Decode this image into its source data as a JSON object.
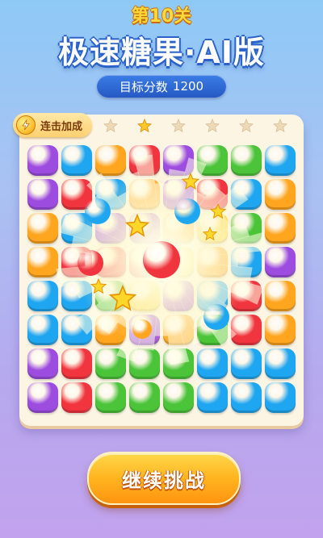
{
  "header": {
    "level_label": "第10关",
    "game_title": "极速糖果·AI版",
    "target_label": "目标分数",
    "target_score": "1200"
  },
  "combo_badge": {
    "label": "连击加成",
    "icon": "lightning-icon"
  },
  "progress_stars": {
    "total": 6,
    "active_index": 1
  },
  "board": {
    "columns": 8,
    "rows": 8,
    "cells": [
      [
        "purple",
        "blue",
        "orange",
        "red",
        "purple",
        "green",
        "green",
        "blue"
      ],
      [
        "purple",
        "red",
        "blue",
        "orange",
        "purple",
        "red",
        "blue",
        "orange"
      ],
      [
        "orange",
        "blue",
        "purple",
        "purple",
        "orange",
        "yellow",
        "green",
        "orange"
      ],
      [
        "orange",
        "red",
        "red",
        "red",
        "yellow",
        "orange",
        "blue",
        "purple"
      ],
      [
        "blue",
        "blue",
        "green",
        "yellow",
        "purple",
        "blue",
        "red",
        "orange"
      ],
      [
        "blue",
        "blue",
        "orange",
        "purple",
        "orange",
        "green",
        "red",
        "orange"
      ],
      [
        "purple",
        "red",
        "green",
        "green",
        "green",
        "blue",
        "blue",
        "blue"
      ],
      [
        "purple",
        "red",
        "green",
        "green",
        "green",
        "blue",
        "blue",
        "blue"
      ]
    ]
  },
  "colors": {
    "red": "#f0353f",
    "blue": "#1fa6f0",
    "orange": "#ffa51e",
    "purple": "#9d4ce0",
    "green": "#4bc43a",
    "yellow": "#ffd22a",
    "star_active": "#ffc72a",
    "star_inactive": "#ecd9b6"
  },
  "actions": {
    "continue_label": "继续挑战"
  }
}
